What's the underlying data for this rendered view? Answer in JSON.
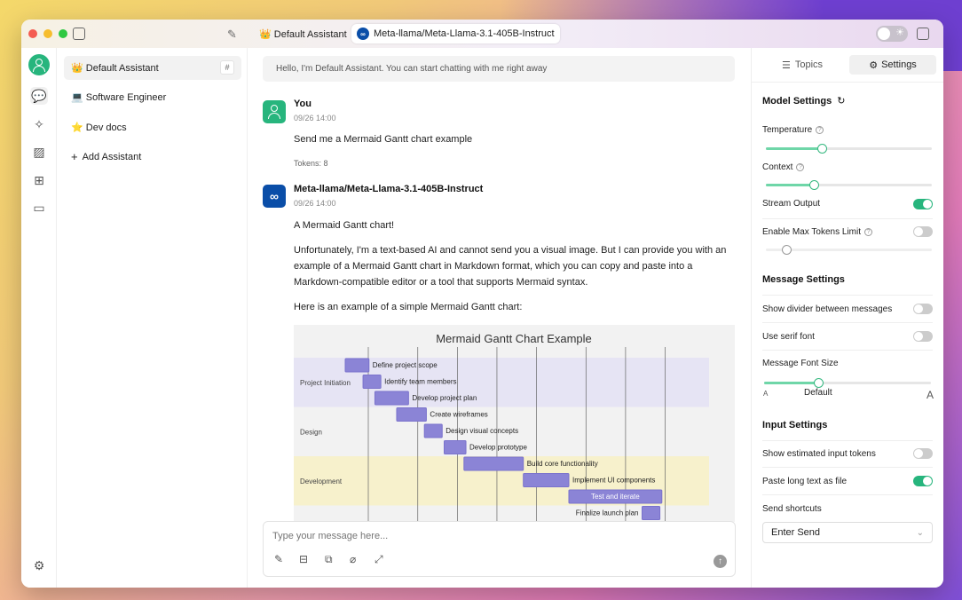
{
  "window": {
    "tabs": [
      {
        "label": "👑 Default Assistant"
      },
      {
        "label": "Meta-llama/Meta-Llama-3.1-405B-Instruct",
        "icon": "meta-icon"
      }
    ]
  },
  "assistants": {
    "items": [
      {
        "label": "👑 Default Assistant",
        "selected": true,
        "badge": "#"
      },
      {
        "label": "💻 Software Engineer"
      },
      {
        "label": "⭐ Dev docs"
      },
      {
        "label": "Add Assistant",
        "icon": "plus-icon"
      }
    ]
  },
  "chat": {
    "welcome": "Hello, I'm Default Assistant. You can start chatting with me right away",
    "messages": [
      {
        "author": "You",
        "time": "09/26 14:00",
        "text": "Send me a Mermaid Gantt chart example",
        "tokens": "Tokens: 8"
      },
      {
        "author": "Meta-llama/Meta-Llama-3.1-405B-Instruct",
        "time": "09/26 14:00",
        "p1": "A Mermaid Gantt chart!",
        "p2a": "Unfortunately, I'm a text-based AI and cannot send you a visual image. But I can provide you with an",
        "p2b": "example of a Mermaid Gantt chart in Markdown format, which you can copy and paste into a",
        "p2c": "Markdown-compatible editor or a tool that supports Mermaid syntax.",
        "p3": "Here is an example of a simple Mermaid Gantt chart:"
      }
    ],
    "input_placeholder": "Type your message here..."
  },
  "gantt": {
    "title": "Mermaid Gantt Chart Example",
    "sections": [
      "Project Initiation",
      "Design",
      "Development"
    ],
    "tasks": [
      {
        "label": "Define project scope",
        "start": 0,
        "end": 1.2,
        "row": 0
      },
      {
        "label": "Identify team members",
        "start": 0.9,
        "end": 1.8,
        "row": 1
      },
      {
        "label": "Develop project plan",
        "start": 1.5,
        "end": 3.2,
        "row": 2
      },
      {
        "label": "Create wireframes",
        "start": 2.6,
        "end": 4.1,
        "row": 3
      },
      {
        "label": "Design visual concepts",
        "start": 4.0,
        "end": 4.9,
        "row": 4
      },
      {
        "label": "Develop prototype",
        "start": 5.0,
        "end": 6.1,
        "row": 5
      },
      {
        "label": "Build core functionality",
        "start": 6.0,
        "end": 9.0,
        "row": 6
      },
      {
        "label": "Implement UI components",
        "start": 9.0,
        "end": 11.3,
        "row": 7
      },
      {
        "label": "Test and iterate",
        "start": 11.3,
        "end": 16.0,
        "row": 8
      },
      {
        "label": "Finalize launch plan",
        "start": 15.0,
        "end": 15.9,
        "row": 9
      }
    ]
  },
  "side": {
    "tabs": [
      "Topics",
      "Settings"
    ],
    "model_settings": "Model Settings",
    "temperature": "Temperature",
    "temperature_value": 0.35,
    "context": "Context",
    "context_value": 0.3,
    "stream_output": "Stream Output",
    "stream_output_on": true,
    "max_tokens": "Enable Max Tokens Limit",
    "max_tokens_on": false,
    "message_settings": "Message Settings",
    "divider": "Show divider between messages",
    "serif": "Use serif font",
    "font_size": "Message Font Size",
    "font_small": "A",
    "font_default": "Default",
    "font_large": "A",
    "input_settings": "Input Settings",
    "est_tokens": "Show estimated input tokens",
    "paste_long": "Paste long text as file",
    "shortcuts": "Send shortcuts",
    "shortcut_value": "Enter Send"
  },
  "colors": {
    "accent": "#27b57d",
    "bar": "#8b84d6",
    "bar_dark": "#7a72cc",
    "section_a": "#e6e4f4",
    "section_c": "#f7f1cc"
  }
}
